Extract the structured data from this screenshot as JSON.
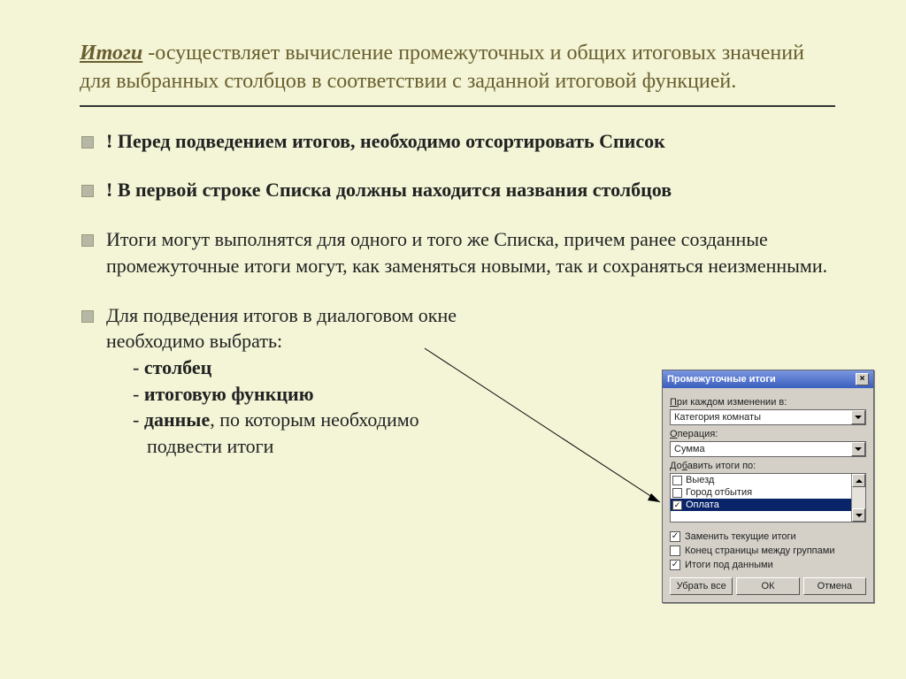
{
  "header": {
    "title_word": "Итоги",
    "title_rest": " -осуществляет вычисление промежуточных и общих итоговых значений для выбранных столбцов  в соответствии с заданной итоговой функцией."
  },
  "bullets": [
    {
      "text": "! Перед подведением итогов, необходимо отсортировать Список",
      "bold": true
    },
    {
      "text": "! В первой строке Списка должны находится названия столбцов",
      "bold": true
    },
    {
      "text": "Итоги могут выполнятся для одного и того же Списка, причем ранее созданные промежуточные итоги могут, как заменяться новыми, так и сохраняться неизменными.",
      "bold": false
    }
  ],
  "sub_bullet": {
    "lead1": "Для подведения итогов в диалоговом окне",
    "lead2": "необходимо выбрать:",
    "items": [
      {
        "prefix": "- ",
        "bold": "столбец",
        "rest": ""
      },
      {
        "prefix": "-  ",
        "bold": "итоговую функцию",
        "rest": ""
      },
      {
        "prefix": "- ",
        "bold": "данные",
        "rest": ", по которым необходимо"
      }
    ],
    "tail": "подвести итоги"
  },
  "dialog": {
    "title": "Промежуточные итоги",
    "close": "×",
    "label_change": "При каждом изменении в:",
    "combo_change": "Категория комнаты",
    "label_op": "Операция:",
    "combo_op": "Сумма",
    "label_add": "Добавить итоги по:",
    "list": [
      {
        "label": "Выезд",
        "checked": false,
        "selected": false
      },
      {
        "label": "Город отбытия",
        "checked": false,
        "selected": false
      },
      {
        "label": "Оплата",
        "checked": true,
        "selected": true
      }
    ],
    "checks": [
      {
        "label": "Заменить текущие итоги",
        "checked": true
      },
      {
        "label": "Конец страницы между группами",
        "checked": false
      },
      {
        "label": "Итоги под данными",
        "checked": true
      }
    ],
    "buttons": {
      "remove": "Убрать все",
      "ok": "ОК",
      "cancel": "Отмена"
    }
  }
}
